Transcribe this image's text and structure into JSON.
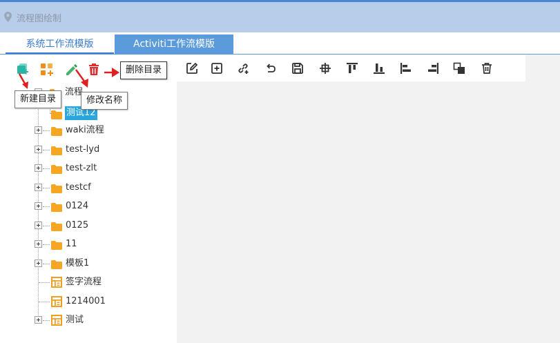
{
  "window": {
    "title": "流程图绘制"
  },
  "tabs": [
    {
      "label": "系统工作流模版",
      "active": true
    },
    {
      "label": "Activiti工作流模版",
      "active": false
    }
  ],
  "left_toolbar": {
    "icons": [
      "new-folder-icon",
      "add-item-icon",
      "edit-pencil-icon",
      "delete-trash-icon"
    ]
  },
  "tooltips": {
    "new_dir": "新建目录",
    "rename": "修改名称",
    "delete_dir": "删除目录"
  },
  "tree": {
    "root_label_partial": "流程",
    "selected_child": "测试12",
    "nodes": [
      {
        "label": "waki流程",
        "type": "folder",
        "expandable": true
      },
      {
        "label": "test-lyd",
        "type": "folder",
        "expandable": true
      },
      {
        "label": "test-zlt",
        "type": "folder",
        "expandable": true
      },
      {
        "label": "testcf",
        "type": "folder",
        "expandable": true
      },
      {
        "label": "0124",
        "type": "folder",
        "expandable": true
      },
      {
        "label": "0125",
        "type": "folder",
        "expandable": true
      },
      {
        "label": "11",
        "type": "folder",
        "expandable": true
      },
      {
        "label": "模板1",
        "type": "folder",
        "expandable": true
      },
      {
        "label": "签字流程",
        "type": "template",
        "expandable": false
      },
      {
        "label": "1214001",
        "type": "template",
        "expandable": false
      },
      {
        "label": "测试",
        "type": "template",
        "expandable": true
      }
    ]
  },
  "right_toolbar": {
    "icons": [
      "edit-square-icon",
      "add-square-icon",
      "link-icon",
      "undo-icon",
      "save-icon",
      "center-icon",
      "align-top-icon",
      "align-bottom-icon",
      "align-left-icon",
      "align-right-icon",
      "layer-icon",
      "trash-icon"
    ]
  },
  "colors": {
    "accent_blue": "#3b7bd6",
    "tab_inactive": "#5b9bdc",
    "title_bar": "#b8cde9",
    "folder": "#f5a623",
    "teal": "#2ab5a3",
    "orange": "#f08c1a",
    "red": "#e02b2b",
    "green": "#41b36b",
    "selected": "#29a7dd"
  }
}
